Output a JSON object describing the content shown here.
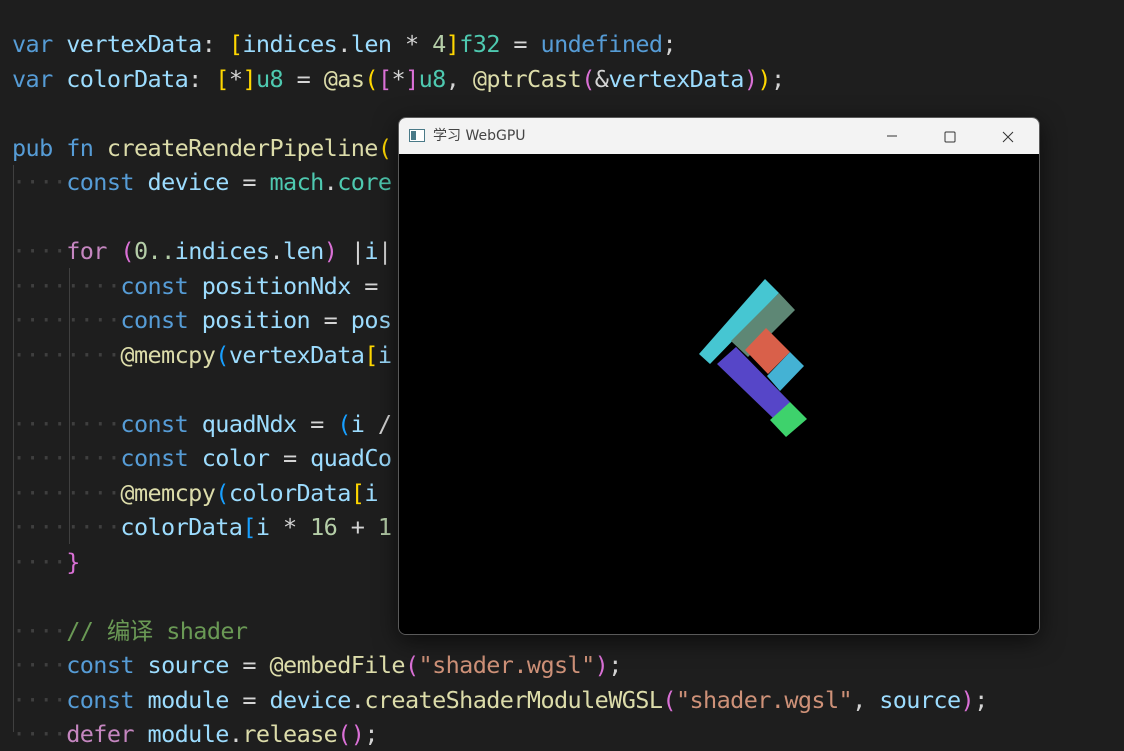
{
  "editor": {
    "lines": [
      {
        "indent": 0,
        "tokens": [
          [
            "var",
            "kw"
          ],
          [
            " ",
            ""
          ],
          [
            "vertexData",
            "var"
          ],
          [
            ": ",
            "op"
          ],
          [
            "[",
            "b1"
          ],
          [
            "indices",
            "var"
          ],
          [
            ".",
            "op"
          ],
          [
            "len",
            "var"
          ],
          [
            " * ",
            "op"
          ],
          [
            "4",
            "num"
          ],
          [
            "]",
            "b1"
          ],
          [
            "f32",
            "type"
          ],
          [
            " = ",
            "op"
          ],
          [
            "undefined",
            "kw"
          ],
          [
            ";",
            "op"
          ]
        ]
      },
      {
        "indent": 0,
        "tokens": [
          [
            "var",
            "kw"
          ],
          [
            " ",
            ""
          ],
          [
            "colorData",
            "var"
          ],
          [
            ": ",
            "op"
          ],
          [
            "[",
            "b1"
          ],
          [
            "*",
            "op"
          ],
          [
            "]",
            "b1"
          ],
          [
            "u8",
            "type"
          ],
          [
            " = ",
            "op"
          ],
          [
            "@as",
            "fn"
          ],
          [
            "(",
            "b1"
          ],
          [
            "[",
            "b2"
          ],
          [
            "*",
            "op"
          ],
          [
            "]",
            "b2"
          ],
          [
            "u8",
            "type"
          ],
          [
            ", ",
            "op"
          ],
          [
            "@ptrCast",
            "fn"
          ],
          [
            "(",
            "b2"
          ],
          [
            "&",
            "op"
          ],
          [
            "vertexData",
            "var"
          ],
          [
            ")",
            "b2"
          ],
          [
            ")",
            "b1"
          ],
          [
            ";",
            "op"
          ]
        ]
      },
      {
        "indent": 0,
        "tokens": []
      },
      {
        "indent": 0,
        "tokens": [
          [
            "pub",
            "kw"
          ],
          [
            " ",
            ""
          ],
          [
            "fn",
            "kw"
          ],
          [
            " ",
            ""
          ],
          [
            "createRenderPipeline",
            "fn"
          ],
          [
            "(",
            "b1"
          ]
        ]
      },
      {
        "indent": 1,
        "tokens": [
          [
            "const",
            "kw"
          ],
          [
            " ",
            ""
          ],
          [
            "device",
            "var"
          ],
          [
            " = ",
            "op"
          ],
          [
            "mach",
            "type"
          ],
          [
            ".",
            "op"
          ],
          [
            "core",
            "type"
          ]
        ]
      },
      {
        "indent": 0,
        "tokens": []
      },
      {
        "indent": 1,
        "tokens": [
          [
            "for",
            "kw2"
          ],
          [
            " ",
            ""
          ],
          [
            "(",
            "b2"
          ],
          [
            "0..",
            "num"
          ],
          [
            "indices",
            "var"
          ],
          [
            ".",
            "op"
          ],
          [
            "len",
            "var"
          ],
          [
            ")",
            "b2"
          ],
          [
            " ",
            ""
          ],
          [
            "|",
            "op"
          ],
          [
            "i",
            "var"
          ],
          [
            "|",
            "op"
          ]
        ]
      },
      {
        "indent": 2,
        "tokens": [
          [
            "const",
            "kw"
          ],
          [
            " ",
            ""
          ],
          [
            "positionNdx",
            "var"
          ],
          [
            " = ",
            "op"
          ]
        ]
      },
      {
        "indent": 2,
        "tokens": [
          [
            "const",
            "kw"
          ],
          [
            " ",
            ""
          ],
          [
            "position",
            "var"
          ],
          [
            " = ",
            "op"
          ],
          [
            "pos",
            "var"
          ]
        ]
      },
      {
        "indent": 2,
        "tokens": [
          [
            "@memcpy",
            "fn"
          ],
          [
            "(",
            "b3"
          ],
          [
            "vertexData",
            "var"
          ],
          [
            "[",
            "b1"
          ],
          [
            "i",
            "var"
          ]
        ]
      },
      {
        "indent": 0,
        "tokens": []
      },
      {
        "indent": 2,
        "tokens": [
          [
            "const",
            "kw"
          ],
          [
            " ",
            ""
          ],
          [
            "quadNdx",
            "var"
          ],
          [
            " = ",
            "op"
          ],
          [
            "(",
            "b3"
          ],
          [
            "i",
            "var"
          ],
          [
            " /",
            "op"
          ]
        ]
      },
      {
        "indent": 2,
        "tokens": [
          [
            "const",
            "kw"
          ],
          [
            " ",
            ""
          ],
          [
            "color",
            "var"
          ],
          [
            " = ",
            "op"
          ],
          [
            "quadCo",
            "var"
          ]
        ]
      },
      {
        "indent": 2,
        "tokens": [
          [
            "@memcpy",
            "fn"
          ],
          [
            "(",
            "b3"
          ],
          [
            "colorData",
            "var"
          ],
          [
            "[",
            "b1"
          ],
          [
            "i",
            "var"
          ]
        ]
      },
      {
        "indent": 2,
        "tokens": [
          [
            "colorData",
            "var"
          ],
          [
            "[",
            "b3"
          ],
          [
            "i",
            "var"
          ],
          [
            " * ",
            "op"
          ],
          [
            "16",
            "num"
          ],
          [
            " + ",
            "op"
          ],
          [
            "1",
            "num"
          ]
        ]
      },
      {
        "indent": 1,
        "tokens": [
          [
            "}",
            "b2"
          ]
        ]
      },
      {
        "indent": 0,
        "tokens": []
      },
      {
        "indent": 1,
        "tokens": [
          [
            "// 编译 shader",
            "cmt"
          ]
        ]
      },
      {
        "indent": 1,
        "tokens": [
          [
            "const",
            "kw"
          ],
          [
            " ",
            ""
          ],
          [
            "source",
            "var"
          ],
          [
            " = ",
            "op"
          ],
          [
            "@embedFile",
            "fn"
          ],
          [
            "(",
            "b2"
          ],
          [
            "\"shader.wgsl\"",
            "str"
          ],
          [
            ")",
            "b2"
          ],
          [
            ";",
            "op"
          ]
        ]
      },
      {
        "indent": 1,
        "tokens": [
          [
            "const",
            "kw"
          ],
          [
            " ",
            ""
          ],
          [
            "module",
            "var"
          ],
          [
            " = ",
            "op"
          ],
          [
            "device",
            "var"
          ],
          [
            ".",
            "op"
          ],
          [
            "createShaderModuleWGSL",
            "fn"
          ],
          [
            "(",
            "b2"
          ],
          [
            "\"shader.wgsl\"",
            "str"
          ],
          [
            ", ",
            "op"
          ],
          [
            "source",
            "var"
          ],
          [
            ")",
            "b2"
          ],
          [
            ";",
            "op"
          ]
        ]
      },
      {
        "indent": 1,
        "tokens": [
          [
            "defer",
            "kw2"
          ],
          [
            " ",
            ""
          ],
          [
            "module",
            "var"
          ],
          [
            ".",
            "op"
          ],
          [
            "release",
            "fn"
          ],
          [
            "(",
            "b2"
          ],
          [
            ")",
            "b2"
          ],
          [
            ";",
            "op"
          ]
        ]
      }
    ]
  },
  "window": {
    "title": "学习 WebGPU",
    "controls": {
      "minimize": "minimize-icon",
      "maximize": "maximize-icon",
      "close": "close-icon"
    }
  },
  "shapes": {
    "colors": {
      "cyan": "#46c6d2",
      "slate": "#5e8775",
      "orange": "#d9604a",
      "sky": "#44b2d4",
      "indigo": "#5646c8",
      "green": "#3ed26c"
    }
  }
}
